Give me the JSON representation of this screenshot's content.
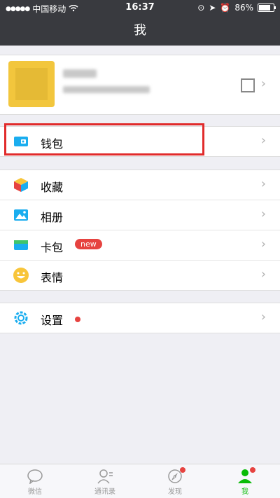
{
  "status": {
    "carrier": "中国移动",
    "time": "16:37",
    "battery": "86%"
  },
  "header": {
    "title": "我"
  },
  "menu": {
    "wallet": "钱包",
    "favorites": "收藏",
    "album": "相册",
    "cards": "卡包",
    "cards_badge": "new",
    "stickers": "表情",
    "settings": "设置"
  },
  "tabs": [
    {
      "label": "微信"
    },
    {
      "label": "通讯录"
    },
    {
      "label": "发现"
    },
    {
      "label": "我"
    }
  ],
  "colors": {
    "accent_green": "#09bb07",
    "red": "#e64340",
    "dark_bar": "#393a3f"
  }
}
